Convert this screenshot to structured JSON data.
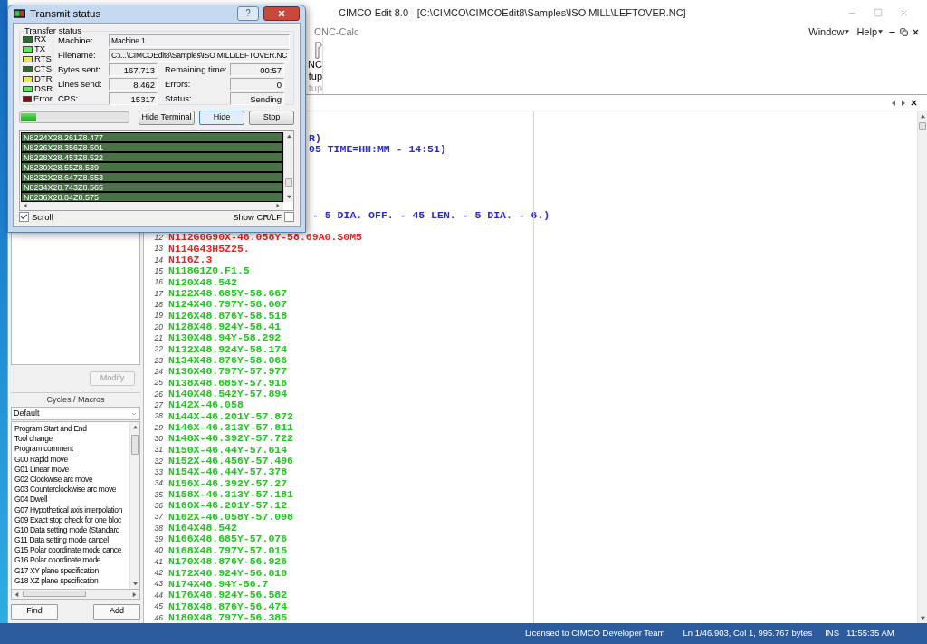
{
  "main_window": {
    "title": "CIMCO Edit 8.0 - [C:\\CIMCO\\CIMCOEdit8\\Samples\\ISO MILL\\LEFTOVER.NC]"
  },
  "menu": [
    {
      "label": "CNC-Calc",
      "kind": "tab"
    },
    {
      "label": "Window",
      "kind": "dropdown"
    },
    {
      "label": "Help",
      "kind": "dropdown"
    }
  ],
  "ribbon": {
    "button_label_lines": [
      "NC",
      "tup"
    ],
    "group_label": "tup"
  },
  "left_panel": {
    "modify_button": {
      "label": "Modify",
      "disabled": true
    },
    "macros_header": "Cycles / Macros",
    "macro_set": "Default",
    "macros": [
      "Program Start and End",
      "Tool change",
      "Program comment",
      "G00 Rapid move",
      "G01 Linear move",
      "G02 Clockwise arc move",
      "G03 Counterclockwise arc move",
      "G04 Dwell",
      "G07 Hypothetical axis interpolation",
      "G09 Exact stop check for one bloc",
      "G10 Data setting mode (Standard",
      "G11 Data setting mode cancel",
      "G15 Polar coordinate mode cance",
      "G16 Polar coordinate mode",
      "G17 XY plane specification",
      "G18 XZ plane specification"
    ],
    "buttons": [
      "Find",
      "Add"
    ]
  },
  "editor": {
    "fragments": [
      {
        "text": "R)",
        "color": "#2a2acf"
      },
      {
        "text": "05 TIME=HH:MM - 14:51)",
        "color": "#2a2acf"
      },
      {
        "text": "- 5 DIA. OFF. - 45 LEN. - 5 DIA. - 6.)",
        "color": "#2a2acf"
      }
    ],
    "lines": [
      {
        "number": "12",
        "text": "N112G0G90X-46.058Y-58.69A0.S0M5",
        "color": "#e02424"
      },
      {
        "number": "13",
        "text": "N114G43H5Z25.",
        "color": "#e02424"
      },
      {
        "number": "14",
        "text": "N116Z.3",
        "color": "#e02424"
      },
      {
        "number": "15",
        "text": "N118G1Z0.F1.5",
        "color": "#22c422"
      },
      {
        "number": "16",
        "text": "N120X48.542",
        "color": "#22c422"
      },
      {
        "number": "17",
        "text": "N122X48.685Y-58.667",
        "color": "#22c422"
      },
      {
        "number": "18",
        "text": "N124X48.797Y-58.607",
        "color": "#22c422"
      },
      {
        "number": "19",
        "text": "N126X48.876Y-58.518",
        "color": "#22c422"
      },
      {
        "number": "20",
        "text": "N128X48.924Y-58.41",
        "color": "#22c422"
      },
      {
        "number": "21",
        "text": "N130X48.94Y-58.292",
        "color": "#22c422"
      },
      {
        "number": "22",
        "text": "N132X48.924Y-58.174",
        "color": "#22c422"
      },
      {
        "number": "23",
        "text": "N134X48.876Y-58.066",
        "color": "#22c422"
      },
      {
        "number": "24",
        "text": "N136X48.797Y-57.977",
        "color": "#22c422"
      },
      {
        "number": "25",
        "text": "N138X48.685Y-57.916",
        "color": "#22c422"
      },
      {
        "number": "26",
        "text": "N140X48.542Y-57.894",
        "color": "#22c422"
      },
      {
        "number": "27",
        "text": "N142X-46.058",
        "color": "#22c422"
      },
      {
        "number": "28",
        "text": "N144X-46.201Y-57.872",
        "color": "#22c422"
      },
      {
        "number": "29",
        "text": "N146X-46.313Y-57.811",
        "color": "#22c422"
      },
      {
        "number": "30",
        "text": "N148X-46.392Y-57.722",
        "color": "#22c422"
      },
      {
        "number": "31",
        "text": "N150X-46.44Y-57.614",
        "color": "#22c422"
      },
      {
        "number": "32",
        "text": "N152X-46.456Y-57.496",
        "color": "#22c422"
      },
      {
        "number": "33",
        "text": "N154X-46.44Y-57.378",
        "color": "#22c422"
      },
      {
        "number": "34",
        "text": "N156X-46.392Y-57.27",
        "color": "#22c422"
      },
      {
        "number": "35",
        "text": "N158X-46.313Y-57.181",
        "color": "#22c422"
      },
      {
        "number": "36",
        "text": "N160X-46.201Y-57.12",
        "color": "#22c422"
      },
      {
        "number": "37",
        "text": "N162X-46.058Y-57.098",
        "color": "#22c422"
      },
      {
        "number": "38",
        "text": "N164X48.542",
        "color": "#22c422"
      },
      {
        "number": "39",
        "text": "N166X48.685Y-57.076",
        "color": "#22c422"
      },
      {
        "number": "40",
        "text": "N168X48.797Y-57.015",
        "color": "#22c422"
      },
      {
        "number": "41",
        "text": "N170X48.876Y-56.926",
        "color": "#22c422"
      },
      {
        "number": "42",
        "text": "N172X48.924Y-56.818",
        "color": "#22c422"
      },
      {
        "number": "43",
        "text": "N174X48.94Y-56.7",
        "color": "#22c422"
      },
      {
        "number": "44",
        "text": "N176X48.924Y-56.582",
        "color": "#22c422"
      },
      {
        "number": "45",
        "text": "N178X48.876Y-56.474",
        "color": "#22c422"
      },
      {
        "number": "46",
        "text": "N180X48.797Y-56.385",
        "color": "#22c422"
      }
    ]
  },
  "status_bar": {
    "license": "Licensed to CIMCO Developer Team",
    "position": "Ln 1/46.903, Col 1, 995.767 bytes",
    "mode": "INS",
    "time": "11:55:35 AM"
  },
  "transmit_dialog": {
    "title": "Transmit status",
    "help_button": "?",
    "group_title": "Transfer status",
    "signals": [
      {
        "label": "RX",
        "color": "#2e6b2e"
      },
      {
        "label": "TX",
        "color": "#66e066"
      },
      {
        "label": "RTS",
        "color": "#e8e860"
      },
      {
        "label": "CTS",
        "color": "#2e6b2e"
      },
      {
        "label": "DTR",
        "color": "#e8e860"
      },
      {
        "label": "DSR",
        "color": "#66e066"
      },
      {
        "label": "Error",
        "color": "#7a1010"
      }
    ],
    "fields": [
      {
        "label": "Machine:",
        "value": "Machine 1",
        "kind": "wide"
      },
      {
        "label": "Filename:",
        "value": "C:\\...\\CIMCOEdit8\\Samples\\ISO MILL\\LEFTOVER.NC",
        "kind": "wide"
      },
      {
        "label": "Bytes sent:",
        "value": "167.713",
        "kind": "number"
      },
      {
        "label": "Remaining time:",
        "value": "00:57",
        "kind": "number"
      },
      {
        "label": "Lines send:",
        "value": "8.462",
        "kind": "number"
      },
      {
        "label": "Errors:",
        "value": "0",
        "kind": "number"
      },
      {
        "label": "CPS:",
        "value": "15317",
        "kind": "number"
      },
      {
        "label": "Status:",
        "value": "Sending",
        "kind": "number"
      }
    ],
    "progress": {
      "level": 0.14
    },
    "buttons": [
      {
        "label": "Hide Terminal",
        "focused": false
      },
      {
        "label": "Hide",
        "focused": true
      },
      {
        "label": "Stop",
        "focused": false
      }
    ],
    "terminal_lines": [
      "N8224X28.261Z8.477",
      "N8226X28.356Z8.501",
      "N8228X28.453Z8.522",
      "N8230X28.55Z8.539",
      "N8232X28.647Z8.553",
      "N8234X28.743Z8.565",
      "N8236X28.84Z8.575"
    ],
    "scroll": {
      "label": "Scroll",
      "checked": true
    },
    "show_crlf": {
      "label": "Show CR/LF",
      "checked": false
    }
  }
}
